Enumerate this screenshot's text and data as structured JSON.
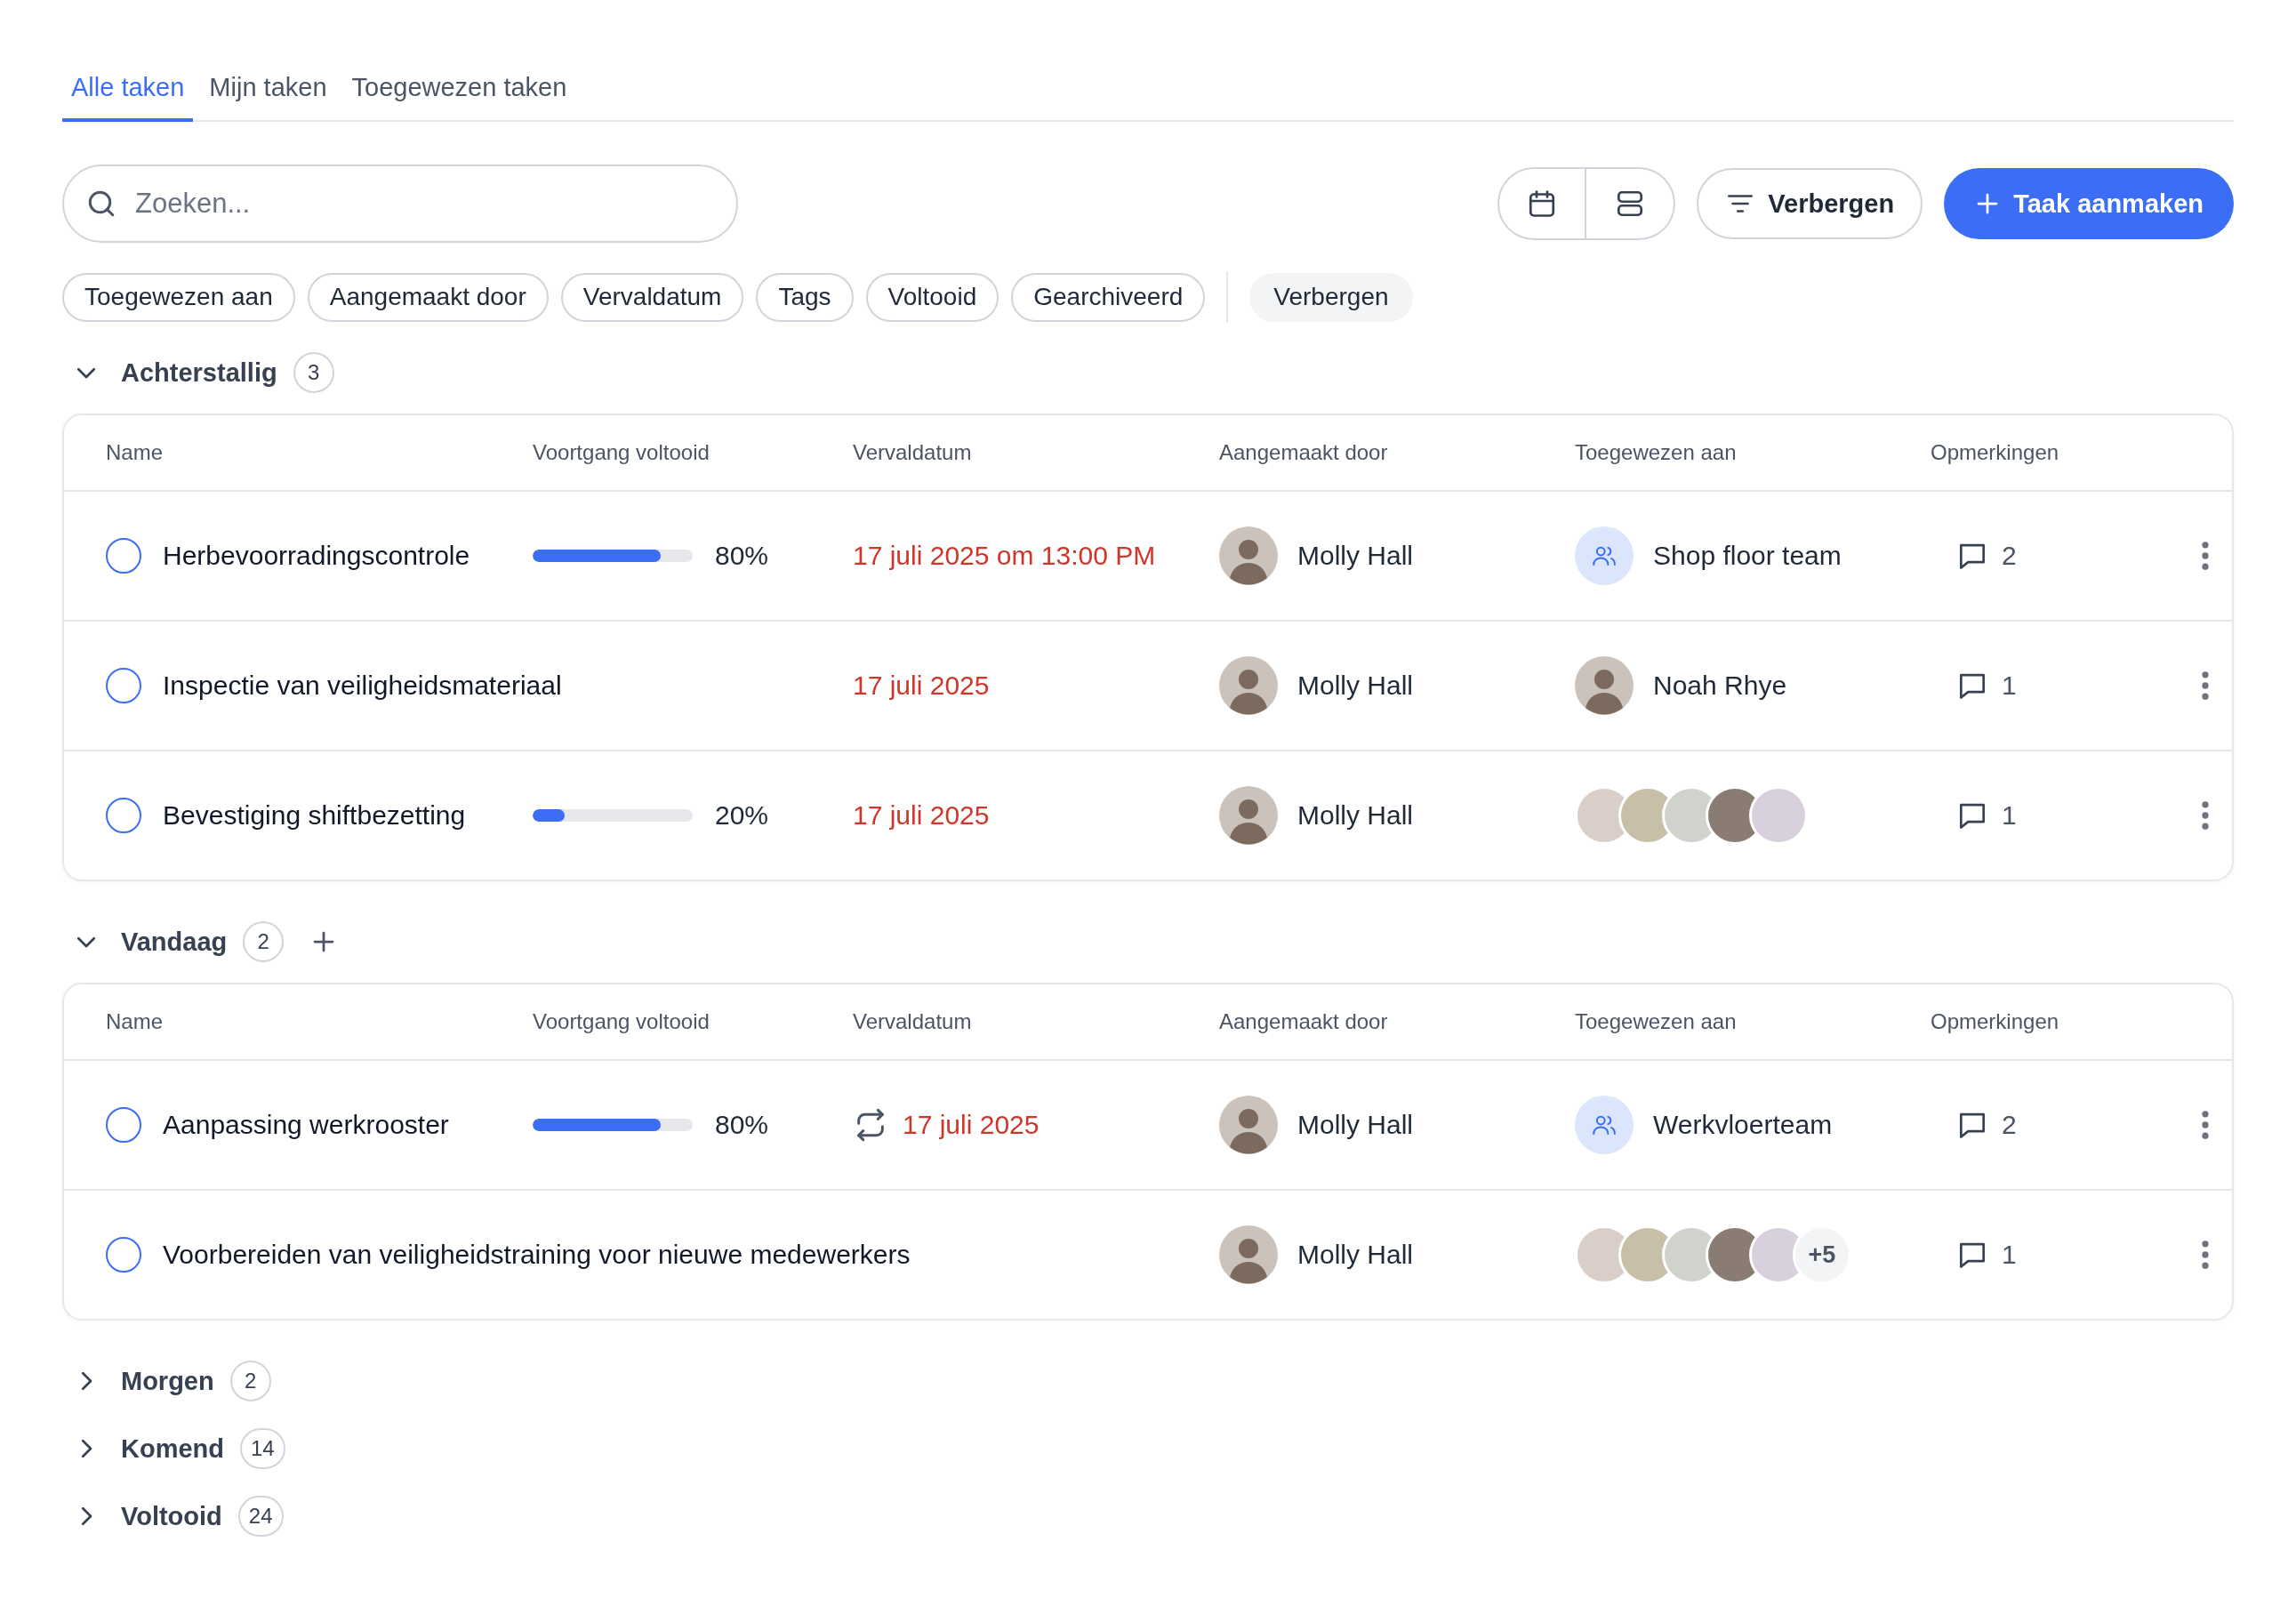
{
  "tabs": [
    {
      "label": "Alle taken",
      "selected": true
    },
    {
      "label": "Mijn taken",
      "selected": false
    },
    {
      "label": "Toegewezen taken",
      "selected": false
    }
  ],
  "search": {
    "placeholder": "Zoeken..."
  },
  "view_buttons": [
    {
      "kind": "calendar"
    },
    {
      "kind": "rows"
    }
  ],
  "hide_button": {
    "label": "Verbergen"
  },
  "create_button": {
    "label": "Taak aanmaken"
  },
  "filters": [
    "Toegewezen aan",
    "Aangemaakt door",
    "Vervaldatum",
    "Tags",
    "Voltooid",
    "Gearchiveerd"
  ],
  "filters_hide": {
    "label": "Verbergen"
  },
  "sections": [
    {
      "title": "Achterstallig",
      "count": "3",
      "expanded": true,
      "add_button": false,
      "columns": [
        "Name",
        "Voortgang voltooid",
        "Vervaldatum",
        "Aangemaakt door",
        "Toegewezen aan",
        "Opmerkingen"
      ],
      "rows": [
        {
          "name": "Herbevoorradingscontrole",
          "checked": false,
          "progress": {
            "level": 0.8,
            "reading": "80%"
          },
          "due": {
            "text": "17 juli 2025 om 13:00 PM",
            "overdue": true,
            "recurring": false
          },
          "creator": "Molly Hall",
          "assignee": {
            "kind": "team",
            "name": "Shop floor team"
          },
          "comments": "2"
        },
        {
          "name": "Inspectie van veiligheidsmateriaal",
          "checked": false,
          "due": {
            "text": "17 juli 2025",
            "overdue": true,
            "recurring": false
          },
          "creator": "Molly Hall",
          "assignee": {
            "kind": "person",
            "name": "Noah Rhye"
          },
          "comments": "1"
        },
        {
          "name": "Bevestiging shiftbezetting",
          "checked": false,
          "progress": {
            "level": 0.2,
            "reading": "20%"
          },
          "due": {
            "text": "17 juli 2025",
            "overdue": true,
            "recurring": false
          },
          "creator": "Molly Hall",
          "assignee": {
            "kind": "group",
            "members": [
              {
                "kind": "photo"
              },
              {
                "kind": "photo"
              },
              {
                "kind": "photo"
              },
              {
                "kind": "photo"
              },
              {
                "kind": "photo"
              }
            ]
          },
          "comments": "1"
        }
      ]
    },
    {
      "title": "Vandaag",
      "count": "2",
      "expanded": true,
      "add_button": true,
      "columns": [
        "Name",
        "Voortgang voltooid",
        "Vervaldatum",
        "Aangemaakt door",
        "Toegewezen aan",
        "Opmerkingen"
      ],
      "rows": [
        {
          "name": "Aanpassing werkrooster",
          "checked": false,
          "progress": {
            "level": 0.8,
            "reading": "80%"
          },
          "due": {
            "text": "17 juli 2025",
            "overdue": true,
            "recurring": true
          },
          "creator": "Molly Hall",
          "assignee": {
            "kind": "team",
            "name": "Werkvloerteam"
          },
          "comments": "2"
        },
        {
          "name": "Voorbereiden van veiligheidstraining voor nieuwe medewerkers",
          "checked": false,
          "creator": "Molly Hall",
          "assignee": {
            "kind": "group",
            "members": [
              {
                "kind": "photo"
              },
              {
                "kind": "photo"
              },
              {
                "kind": "photo"
              },
              {
                "kind": "photo"
              },
              {
                "kind": "photo"
              }
            ],
            "more": "+5"
          },
          "comments": "1"
        }
      ]
    },
    {
      "title": "Morgen",
      "count": "2",
      "expanded": false,
      "add_button": false
    },
    {
      "title": "Komend",
      "count": "14",
      "expanded": false,
      "add_button": false
    },
    {
      "title": "Voltooid",
      "count": "24",
      "expanded": false,
      "add_button": false
    }
  ]
}
